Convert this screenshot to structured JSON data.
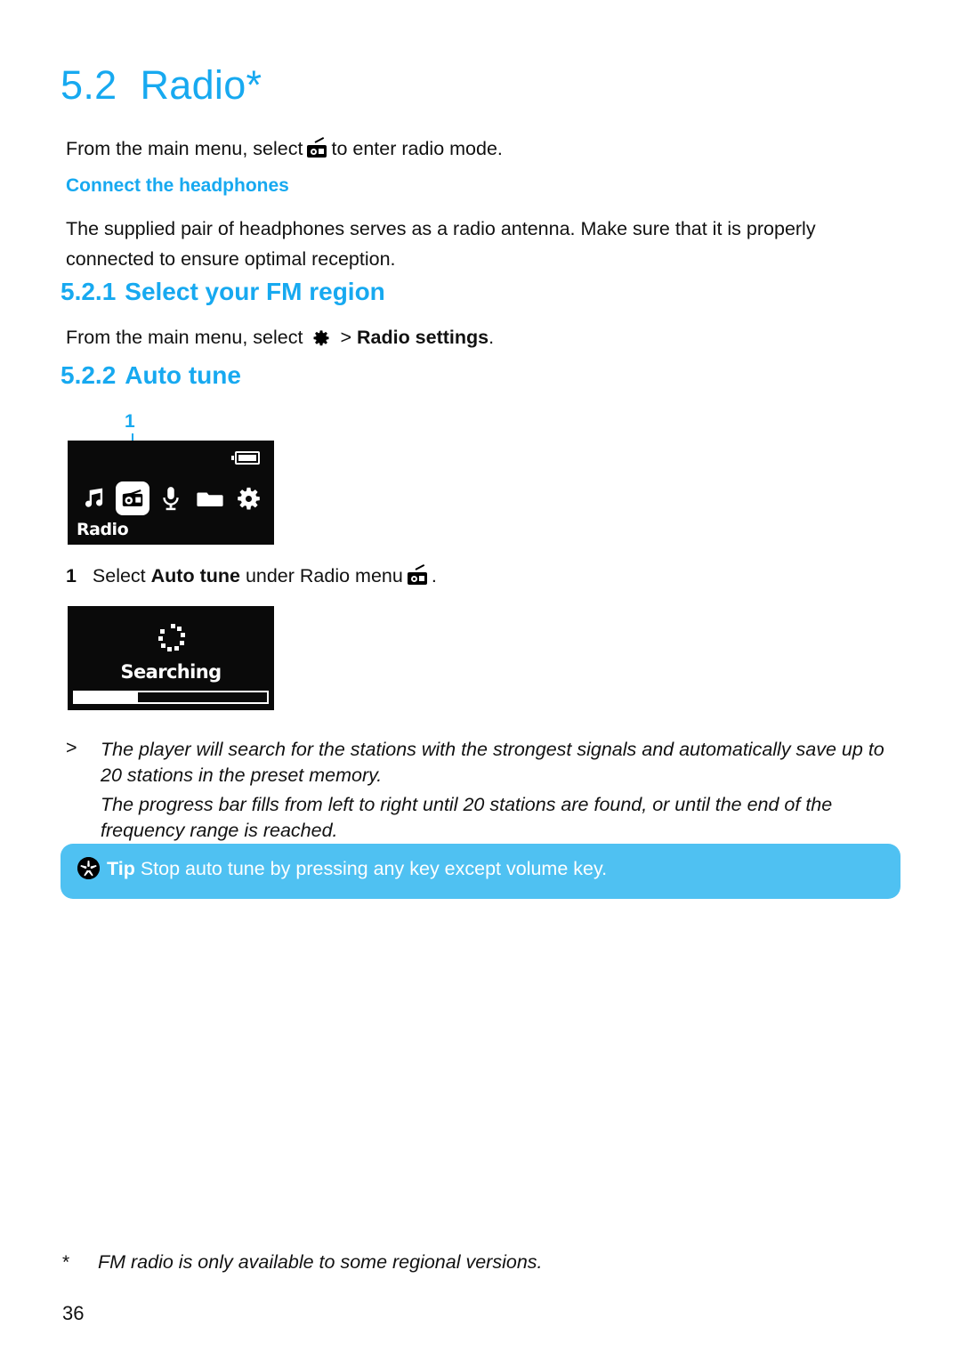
{
  "page": {
    "number": "36"
  },
  "heading_main": {
    "number": "5.2",
    "title": "Radio*"
  },
  "intro": {
    "before_icon": "From the main menu, select",
    "icon": "radio-icon",
    "after_icon": "to enter radio mode."
  },
  "subheading_headphones": "Connect the headphones",
  "headphones_paragraph": "The supplied pair of headphones serves as a radio antenna. Make sure that it is properly connected to ensure optimal reception.",
  "section_521": {
    "number": "5.2.1",
    "title": "Select your FM region",
    "body_before_icon": "From the main menu, select",
    "icon": "gear-icon",
    "separator": ">",
    "body_bold": "Radio settings",
    "body_end": "."
  },
  "section_522": {
    "number": "5.2.2",
    "title": "Auto tune"
  },
  "menu_screen": {
    "callout": "1",
    "label": "Radio",
    "battery_icon": "battery-icon",
    "icons": [
      {
        "name": "music-note-icon",
        "selected": false
      },
      {
        "name": "radio-icon",
        "selected": true
      },
      {
        "name": "microphone-icon",
        "selected": false
      },
      {
        "name": "folder-icon",
        "selected": false
      },
      {
        "name": "gear-icon",
        "selected": false
      }
    ]
  },
  "step_1": {
    "number": "1",
    "text_before_bold": "Select",
    "bold": "Auto tune",
    "text_after_bold": "under Radio menu",
    "icon": "radio-icon",
    "text_end": "."
  },
  "searching_screen": {
    "spinner_icon": "loading-spinner-icon",
    "label": "Searching",
    "progress_percent": 33
  },
  "result": {
    "marker": ">",
    "line1": "The player will search for the stations with the strongest signals and automatically save up to 20 stations in the preset memory.",
    "line2": "The progress bar fills from left to right until 20 stations are found, or until the end of the frequency range is reached."
  },
  "tip": {
    "icon": "tip-asterisk-icon",
    "label": "Tip",
    "text": "Stop auto tune by pressing any key except volume key."
  },
  "footnote": {
    "marker": "*",
    "text": "FM radio is only available to some regional versions."
  },
  "colors": {
    "heading_blue": "#17A9F0",
    "tip_background": "#4FC1F2",
    "screen_background": "#0A0A0A"
  }
}
